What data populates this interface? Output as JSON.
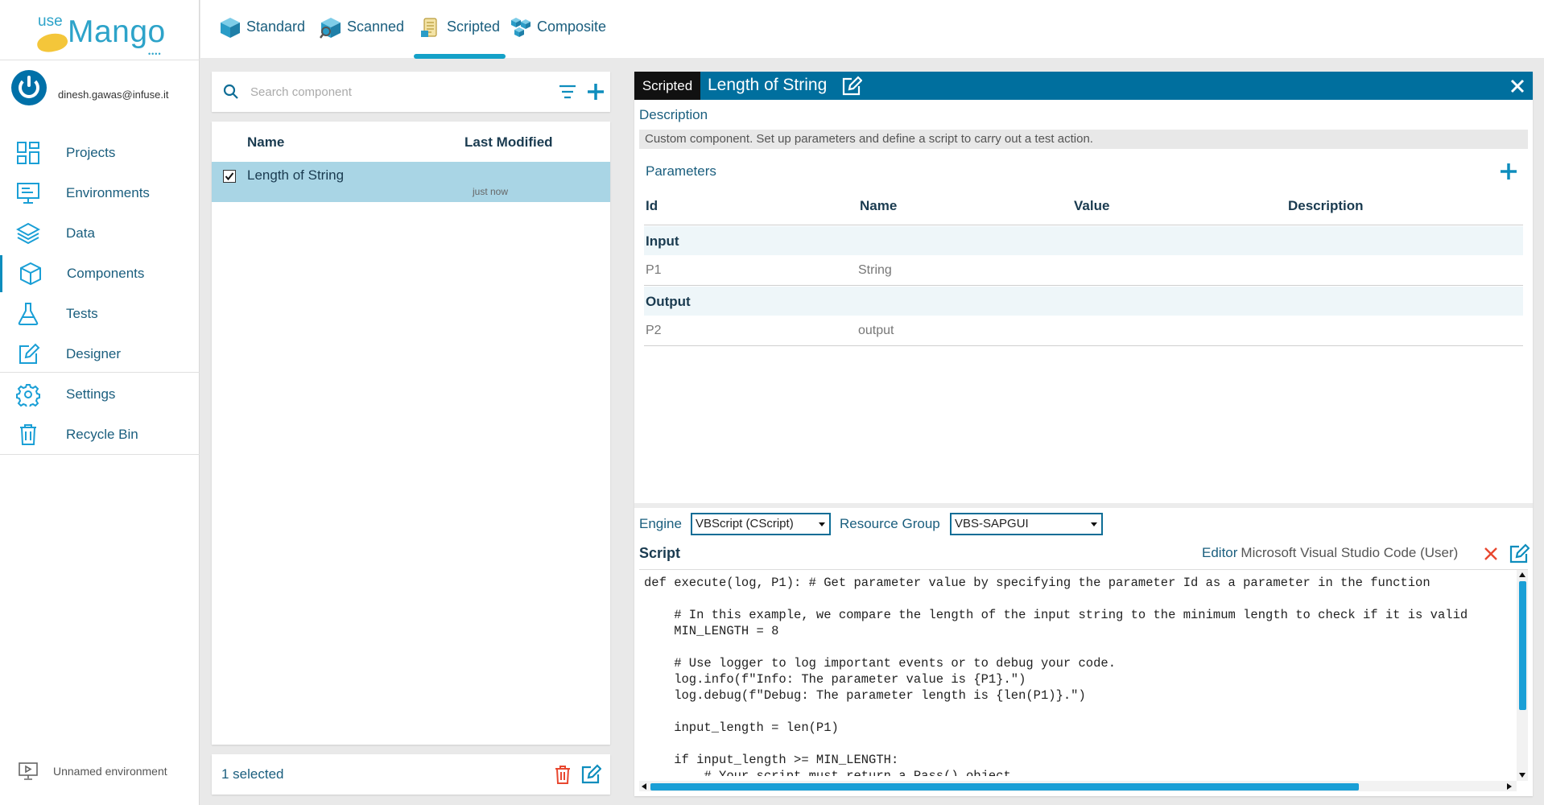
{
  "app": {
    "logo_prefix": "use",
    "logo_name": "Mango"
  },
  "user": {
    "email": "dinesh.gawas@infuse.it"
  },
  "sidebar": {
    "items": [
      {
        "label": "Projects",
        "icon": "projects-icon"
      },
      {
        "label": "Environments",
        "icon": "environments-icon"
      },
      {
        "label": "Data",
        "icon": "data-icon"
      },
      {
        "label": "Components",
        "icon": "components-icon",
        "active": true
      },
      {
        "label": "Tests",
        "icon": "tests-icon"
      },
      {
        "label": "Designer",
        "icon": "designer-icon"
      },
      {
        "label": "Settings",
        "icon": "settings-icon"
      },
      {
        "label": "Recycle Bin",
        "icon": "recycle-bin-icon"
      }
    ],
    "environment": "Unnamed environment"
  },
  "tabs": [
    {
      "label": "Standard"
    },
    {
      "label": "Scanned"
    },
    {
      "label": "Scripted",
      "active": true
    },
    {
      "label": "Composite"
    }
  ],
  "search": {
    "placeholder": "Search component"
  },
  "list": {
    "columns": {
      "name": "Name",
      "modified": "Last Modified"
    },
    "rows": [
      {
        "name": "Length of String",
        "modified": "just now",
        "checked": true
      }
    ],
    "selected_text": "1 selected"
  },
  "detail": {
    "type_tag": "Scripted",
    "title": "Length of String",
    "description_label": "Description",
    "description": "Custom component. Set up parameters and define a script to carry out a test action.",
    "parameters_label": "Parameters",
    "param_columns": {
      "id": "Id",
      "name": "Name",
      "value": "Value",
      "description": "Description"
    },
    "groups": [
      {
        "label": "Input",
        "rows": [
          {
            "id": "P1",
            "name": "String"
          }
        ]
      },
      {
        "label": "Output",
        "rows": [
          {
            "id": "P2",
            "name": "output"
          }
        ]
      }
    ],
    "engine_label": "Engine",
    "engine_value": "VBScript (CScript)",
    "resource_group_label": "Resource Group",
    "resource_group_value": "VBS-SAPGUI",
    "script_label": "Script",
    "editor_label": "Editor",
    "editor_value": "Microsoft Visual Studio Code (User)",
    "script": "def execute(log, P1): # Get parameter value by specifying the parameter Id as a parameter in the function\n\n    # In this example, we compare the length of the input string to the minimum length to check if it is valid\n    MIN_LENGTH = 8\n\n    # Use logger to log important events or to debug your code.\n    log.info(f\"Info: The parameter value is {P1}.\")\n    log.debug(f\"Debug: The parameter length is {len(P1)}.\")\n\n    input_length = len(P1)\n\n    if input_length >= MIN_LENGTH:\n        # Your script must return a Pass() object\n        # You will need to return"
  },
  "colors": {
    "brand": "#2da3c9",
    "header": "#006f9e",
    "selected_row": "#a9d5e5",
    "delete": "#e8472f"
  }
}
